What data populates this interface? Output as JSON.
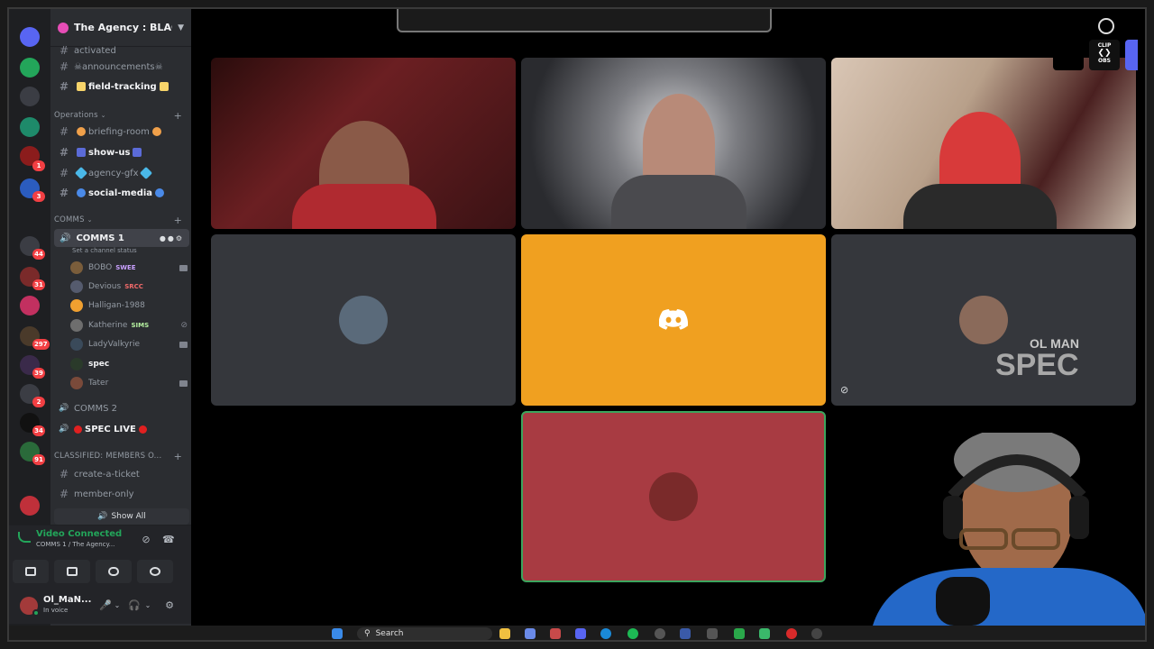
{
  "server": {
    "name": "The Agency : BLACKL..."
  },
  "channels_top": [
    {
      "label": "activated",
      "bright": false
    },
    {
      "label": "☠announcements☠",
      "bright": false
    },
    {
      "label": "field-tracking",
      "bright": true
    }
  ],
  "categories": {
    "operations": "Operations",
    "comms": "COMMS",
    "classified": "CLASSIFIED: MEMBERS O..."
  },
  "channels_ops": [
    {
      "label": "briefing-room",
      "bright": false
    },
    {
      "label": "show-us",
      "bright": true
    },
    {
      "label": "agency-gfx",
      "bright": false
    },
    {
      "label": "social-media",
      "bright": true
    }
  ],
  "voice": {
    "active_channel": "COMMS 1",
    "set_status": "Set a channel status",
    "members": [
      {
        "name": "BOBO",
        "tag": "SWEE",
        "color": "#7a5d3b"
      },
      {
        "name": "Devious",
        "tag": "SRCC",
        "color": "#555b6e"
      },
      {
        "name": "Halligan-1988",
        "tag": "",
        "color": "#f0a030"
      },
      {
        "name": "Katherine",
        "tag": "SIMS",
        "color": "#6e6e6e"
      },
      {
        "name": "LadyValkyrie",
        "tag": "",
        "color": "#3a4a5a"
      },
      {
        "name": "spec",
        "tag": "",
        "color": "#2a3a2a"
      },
      {
        "name": "Tater",
        "tag": "",
        "color": "#7a4a3a"
      }
    ],
    "other_channels": [
      "COMMS 2",
      "SPEC LIVE"
    ]
  },
  "classified_channels": [
    "create-a-ticket",
    "member-only"
  ],
  "show_all": "Show All",
  "voice_panel": {
    "status": "Video Connected",
    "location": "COMMS 1 / The Agency..."
  },
  "user": {
    "name": "Ol_MaN...",
    "status": "In voice"
  },
  "taskbar": {
    "search": "Search"
  },
  "obs": {
    "clip": "CLIP",
    "obs": "OBS"
  },
  "colors": {
    "discord_orange": "#f0a020",
    "tile_red": "#a83b42",
    "tile_gray": "#35373c",
    "online_green": "#23a55a"
  },
  "icons": [
    "discord-logo-icon",
    "hash-icon",
    "speaker-icon",
    "camera-icon",
    "mic-icon",
    "headphones-icon",
    "gear-icon",
    "hangup-icon",
    "search-icon"
  ]
}
